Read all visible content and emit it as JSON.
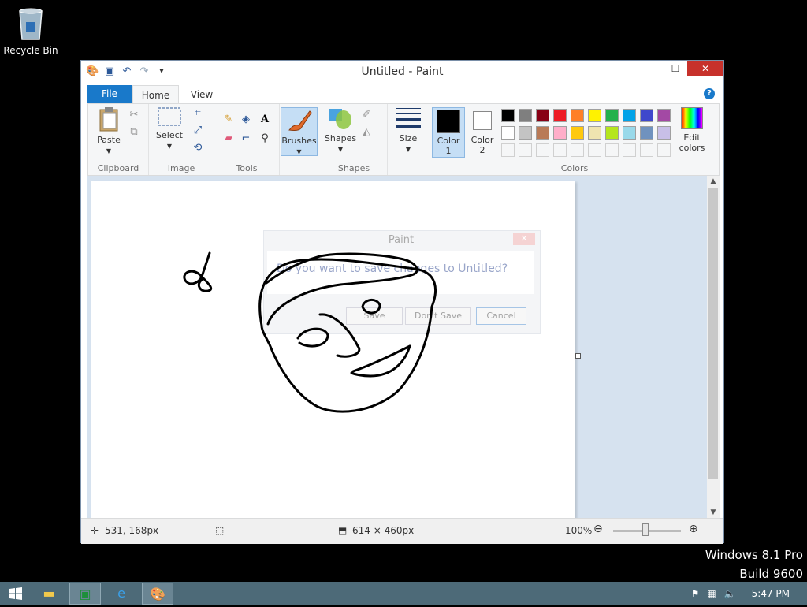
{
  "desktop": {
    "recycle_bin_label": "Recycle Bin",
    "watermark_line1": "Windows 8.1 Pro",
    "watermark_line2": "Build 9600"
  },
  "window": {
    "title": "Untitled - Paint",
    "tabs": {
      "file": "File",
      "home": "Home",
      "view": "View"
    }
  },
  "ribbon": {
    "clipboard": {
      "label": "Clipboard",
      "paste": "Paste"
    },
    "image": {
      "label": "Image",
      "select": "Select"
    },
    "tools": {
      "label": "Tools"
    },
    "brushes": "Brushes",
    "shapes": {
      "label": "Shapes",
      "button": "Shapes"
    },
    "size": "Size",
    "colors": {
      "label": "Colors",
      "color1": "Color",
      "color1_num": "1",
      "color2": "Color",
      "color2_num": "2",
      "edit_colors": "Edit",
      "edit_colors2": "colors",
      "palette_row1": [
        "#000000",
        "#7f7f7f",
        "#880015",
        "#ed1c24",
        "#ff7f27",
        "#fff200",
        "#22b14c",
        "#00a2e8",
        "#3f48cc",
        "#a349a4"
      ],
      "palette_row2": [
        "#ffffff",
        "#c3c3c3",
        "#b97a57",
        "#ffaec9",
        "#ffc90e",
        "#efe4b0",
        "#b5e61d",
        "#99d9ea",
        "#7092be",
        "#c8bfe7"
      ],
      "color1_value": "#000000",
      "color2_value": "#ffffff"
    }
  },
  "dialog": {
    "title": "Paint",
    "message": "Do you want to save changes to Untitled?",
    "save": "Save",
    "dont_save": "Don't Save",
    "cancel": "Cancel"
  },
  "status": {
    "cursor_pos": "531, 168px",
    "image_size": "614 × 460px",
    "zoom": "100%"
  },
  "taskbar": {
    "time": "5:47 PM"
  }
}
